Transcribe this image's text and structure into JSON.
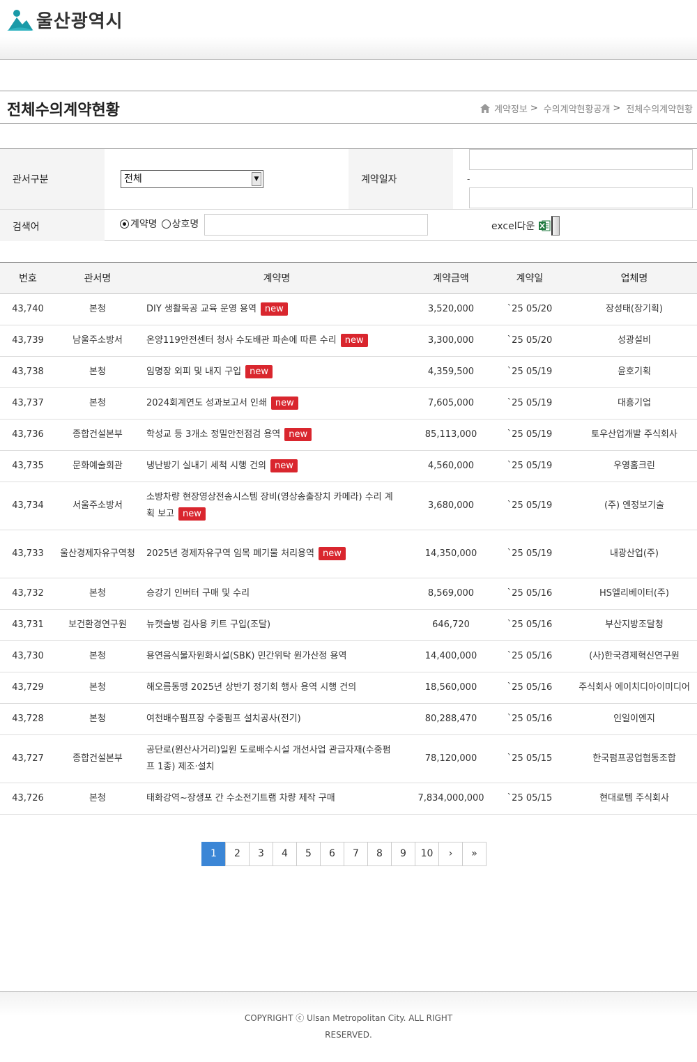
{
  "header": {
    "logo_text": "울산광역시"
  },
  "page": {
    "title": "전체수의계약현황"
  },
  "breadcrumb": {
    "items": [
      "계약정보",
      "수의계약현황공개",
      "전체수의계약현황"
    ],
    "separator": ">"
  },
  "search": {
    "dept_label": "관서구분",
    "dept_selected": "전체",
    "date_label": "계약일자",
    "date_separator": "-",
    "keyword_label": "검색어",
    "radio_contract": "계약명",
    "radio_company": "상호명",
    "excel_label": "excel다운"
  },
  "table": {
    "headers": [
      "번호",
      "관서명",
      "계약명",
      "계약금액",
      "계약일",
      "업체명"
    ],
    "new_badge": "new",
    "rows": [
      {
        "no": "43,740",
        "dept": "본청",
        "name": "DIY 생활목공 교육 운영 용역",
        "amount": "3,520,000",
        "date": "`25 05/20",
        "company": "장성태(장기획)",
        "is_new": true
      },
      {
        "no": "43,739",
        "dept": "남울주소방서",
        "name": "온양119안전센터 청사 수도배관 파손에 따른 수리",
        "amount": "3,300,000",
        "date": "`25 05/20",
        "company": "성광설비",
        "is_new": true
      },
      {
        "no": "43,738",
        "dept": "본청",
        "name": "임명장 외피 및 내지 구입",
        "amount": "4,359,500",
        "date": "`25 05/19",
        "company": "윤호기획",
        "is_new": true
      },
      {
        "no": "43,737",
        "dept": "본청",
        "name": "2024회계연도 성과보고서 인쇄",
        "amount": "7,605,000",
        "date": "`25 05/19",
        "company": "대흥기업",
        "is_new": true
      },
      {
        "no": "43,736",
        "dept": "종합건설본부",
        "name": "학성교 등 3개소 정밀안전점검 용역",
        "amount": "85,113,000",
        "date": "`25 05/19",
        "company": "토우산업개발 주식회사",
        "is_new": true
      },
      {
        "no": "43,735",
        "dept": "문화예술회관",
        "name": "냉난방기 실내기 세척 시행 건의",
        "amount": "4,560,000",
        "date": "`25 05/19",
        "company": "우영홈크린",
        "is_new": true
      },
      {
        "no": "43,734",
        "dept": "서울주소방서",
        "name": "소방차량 현장영상전송시스템 장비(영상송출장치 카메라) 수리 계획 보고",
        "amount": "3,680,000",
        "date": "`25 05/19",
        "company": "(주) 엔정보기술",
        "is_new": true
      },
      {
        "no": "43,733",
        "dept": "울산경제자유구역청",
        "name": "2025년 경제자유구역 임목 폐기물 처리용역",
        "amount": "14,350,000",
        "date": "`25 05/19",
        "company": "내광산업(주)",
        "is_new": true
      },
      {
        "no": "43,732",
        "dept": "본청",
        "name": "승강기 인버터 구매 및 수리",
        "amount": "8,569,000",
        "date": "`25 05/16",
        "company": "HS엘리베이터(주)",
        "is_new": false
      },
      {
        "no": "43,731",
        "dept": "보건환경연구원",
        "name": "뉴캣슬병 검사용 키트 구입(조달)",
        "amount": "646,720",
        "date": "`25 05/16",
        "company": "부산지방조달청",
        "is_new": false
      },
      {
        "no": "43,730",
        "dept": "본청",
        "name": "용연음식물자원화시설(SBK) 민간위탁 원가산정 용역",
        "amount": "14,400,000",
        "date": "`25 05/16",
        "company": "(사)한국경제혁신연구원",
        "is_new": false
      },
      {
        "no": "43,729",
        "dept": "본청",
        "name": "해오름동맹 2025년 상반기 정기회 행사 용역 시행 건의",
        "amount": "18,560,000",
        "date": "`25 05/16",
        "company": "주식회사 에이치디아이미디어",
        "is_new": false
      },
      {
        "no": "43,728",
        "dept": "본청",
        "name": "여천배수펌프장 수중펌프 설치공사(전기)",
        "amount": "80,288,470",
        "date": "`25 05/16",
        "company": "인일이엔지",
        "is_new": false
      },
      {
        "no": "43,727",
        "dept": "종합건설본부",
        "name": "공단로(원산사거리)일원 도로배수시설 개선사업 관급자재(수중펌프 1종) 제조·설치",
        "amount": "78,120,000",
        "date": "`25 05/15",
        "company": "한국펌프공업협동조합",
        "is_new": false
      },
      {
        "no": "43,726",
        "dept": "본청",
        "name": "태화강역~장생포 간 수소전기트램 차량 제작 구매",
        "amount": "7,834,000,000",
        "date": "`25 05/15",
        "company": "현대로템 주식회사",
        "is_new": false
      }
    ]
  },
  "pagination": {
    "pages": [
      "1",
      "2",
      "3",
      "4",
      "5",
      "6",
      "7",
      "8",
      "9",
      "10"
    ],
    "current": "1",
    "next": "›",
    "last": "»"
  },
  "footer": {
    "copyright": "COPYRIGHT ⓒ Ulsan Metropolitan City. ALL RIGHT RESERVED."
  },
  "colors": {
    "accent": "#3b86d6",
    "new_badge": "#d9262e",
    "logo_teal": "#1a9aa8"
  }
}
